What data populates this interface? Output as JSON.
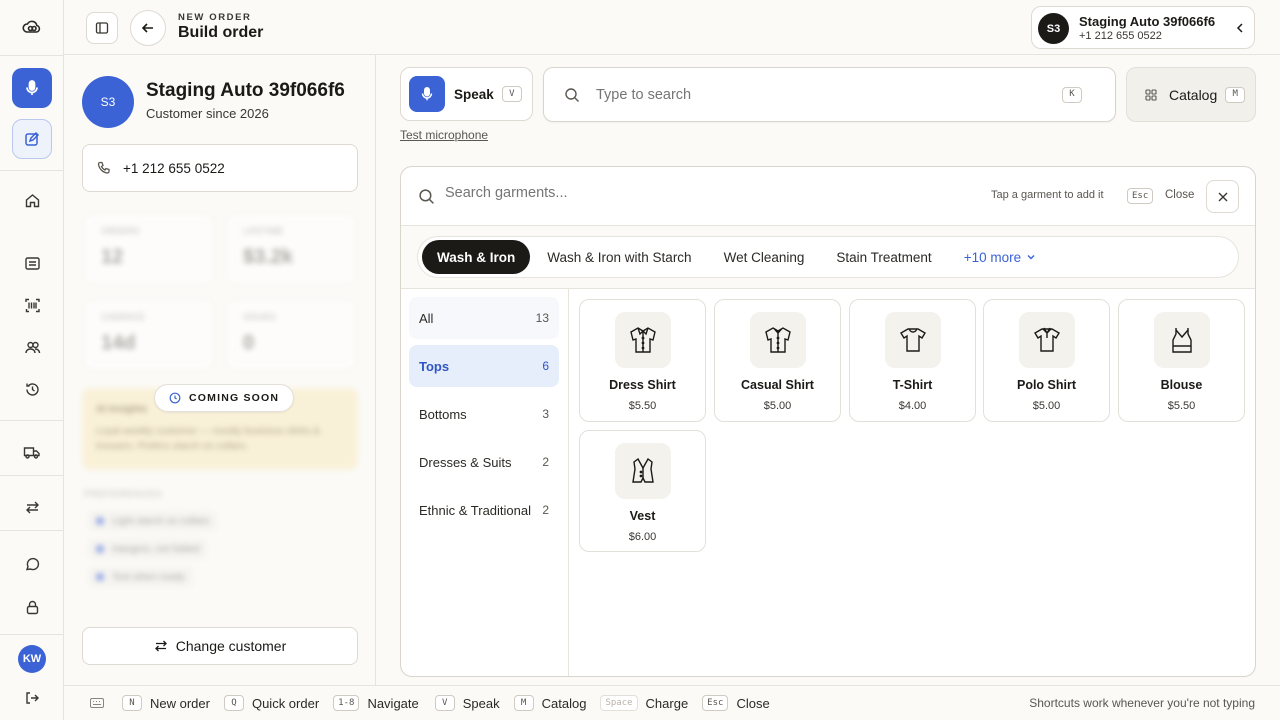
{
  "header": {
    "eyebrow": "NEW ORDER",
    "title": "Build order",
    "customer_initials": "S3",
    "customer_name": "Staging Auto 39f066f6",
    "customer_phone": "+1 212 655 0522"
  },
  "rail": {
    "user_initials": "KW"
  },
  "customer": {
    "initials": "S3",
    "name": "Staging Auto 39f066f6",
    "since": "Customer since 2026",
    "phone": "+1 212 655 0522",
    "stats": [
      {
        "label": "ORDERS",
        "value": "12"
      },
      {
        "label": "LIFETIME",
        "value": "$3.2k"
      },
      {
        "label": "CADENCE",
        "value": "14d"
      },
      {
        "label": "ISSUES",
        "value": "0"
      }
    ],
    "coming_soon": "COMING SOON",
    "insight_title": "AI Insights",
    "insight_text": "Loyal weekly customer — mostly business shirts & trousers. Prefers starch on collars.",
    "preferences_label": "PREFERENCES",
    "preferences": [
      "Light starch on collars",
      "Hangers, not folded",
      "Text when ready"
    ],
    "change_button": "Change customer"
  },
  "toolbar": {
    "speak_label": "Speak",
    "speak_key": "V",
    "search_placeholder": "Type to search",
    "search_key": "K",
    "catalog_label": "Catalog",
    "catalog_key": "M",
    "test_mic": "Test microphone"
  },
  "garments": {
    "search_placeholder": "Search garments...",
    "hint": "Tap a garment to add it",
    "esc_key": "Esc",
    "close_label": "Close",
    "services": [
      "Wash & Iron",
      "Wash & Iron with Starch",
      "Wet Cleaning",
      "Stain Treatment"
    ],
    "more_label": "+10 more",
    "categories": [
      {
        "label": "All",
        "count": "13"
      },
      {
        "label": "Tops",
        "count": "6"
      },
      {
        "label": "Bottoms",
        "count": "3"
      },
      {
        "label": "Dresses & Suits",
        "count": "2"
      },
      {
        "label": "Ethnic & Traditional",
        "count": "2"
      }
    ],
    "items": [
      {
        "name": "Dress Shirt",
        "price": "$5.50",
        "icon": "dress-shirt-icon"
      },
      {
        "name": "Casual Shirt",
        "price": "$5.00",
        "icon": "casual-shirt-icon"
      },
      {
        "name": "T-Shirt",
        "price": "$4.00",
        "icon": "t-shirt-icon"
      },
      {
        "name": "Polo Shirt",
        "price": "$5.00",
        "icon": "polo-shirt-icon"
      },
      {
        "name": "Blouse",
        "price": "$5.50",
        "icon": "blouse-icon"
      },
      {
        "name": "Vest",
        "price": "$6.00",
        "icon": "vest-icon"
      }
    ]
  },
  "footer": {
    "shortcuts": [
      {
        "key": "N",
        "label": "New order"
      },
      {
        "key": "Q",
        "label": "Quick order"
      },
      {
        "key": "1-8",
        "label": "Navigate"
      },
      {
        "key": "V",
        "label": "Speak"
      },
      {
        "key": "M",
        "label": "Catalog"
      },
      {
        "key": "Space",
        "label": "Charge"
      },
      {
        "key": "Esc",
        "label": "Close"
      }
    ],
    "note": "Shortcuts work whenever you're not typing"
  },
  "colors": {
    "accent": "#3b63d6",
    "active_chip": "#1c1a17",
    "selected_category": "#e6eefb"
  }
}
